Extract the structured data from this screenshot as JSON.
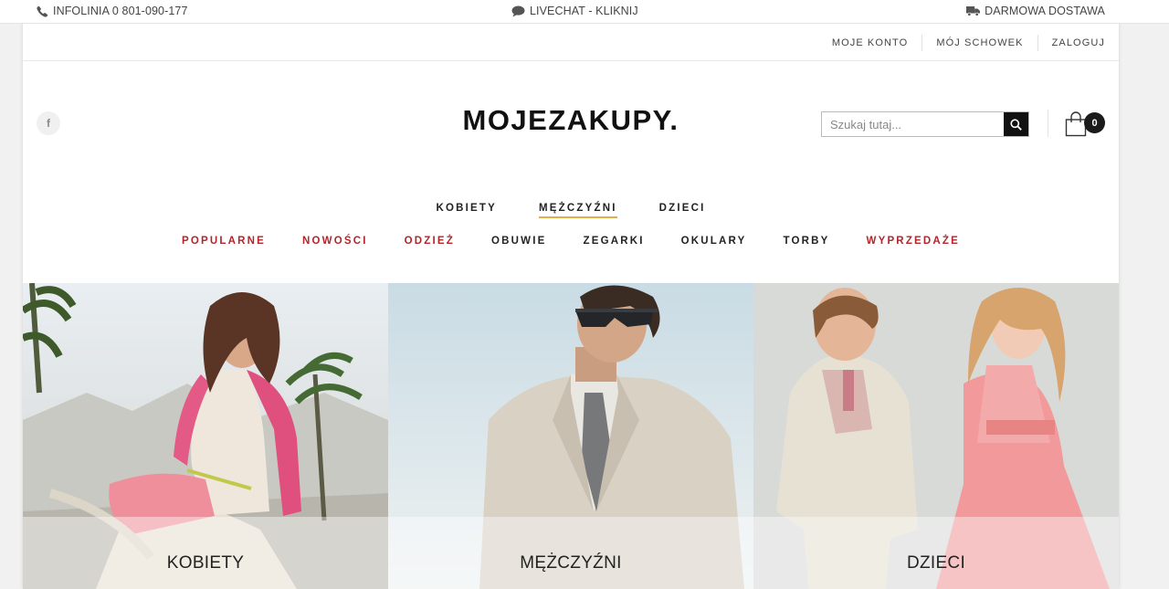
{
  "infobar": {
    "phone": "INFOLINIA 0 801-090-177",
    "chat": "LIVECHAT - KLIKNIJ",
    "shipping": "DARMOWA DOSTAWA"
  },
  "account": {
    "links": [
      "MOJE KONTO",
      "MÓJ SCHOWEK",
      "ZALOGUJ"
    ]
  },
  "header": {
    "logo": "MOJEZAKUPY.",
    "social": "f",
    "search_placeholder": "Szukaj tutaj...",
    "cart_count": "0"
  },
  "mainnav": {
    "items": [
      "KOBIETY",
      "MĘŻCZYŹNI",
      "DZIECI"
    ],
    "active": "MĘŻCZYŹNI"
  },
  "subnav": {
    "items": [
      "POPULARNE",
      "NOWOŚCI",
      "ODZIEŻ",
      "OBUWIE",
      "ZEGARKI",
      "OKULARY",
      "TORBY",
      "WYPRZEDAŻE"
    ]
  },
  "tiles": [
    {
      "label": "KOBIETY"
    },
    {
      "label": "MĘŻCZYŹNI"
    },
    {
      "label": "DZIECI"
    }
  ],
  "colors": {
    "accent_red": "#b3252a",
    "active_underline": "#e2b04a",
    "dark": "#111111"
  }
}
